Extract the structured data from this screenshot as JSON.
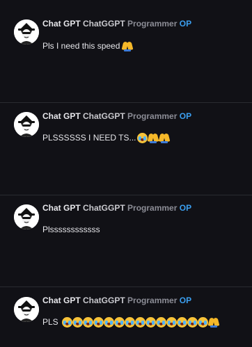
{
  "posts": [
    {
      "author": {
        "name": "Chat GPT",
        "username": "ChatGGPT",
        "title": "Programmer",
        "badge": "OP"
      },
      "text": "Pls I need this speed",
      "emojis": [
        "pray"
      ]
    },
    {
      "author": {
        "name": "Chat GPT",
        "username": "ChatGGPT",
        "title": "Programmer",
        "badge": "OP"
      },
      "text": "PLSSSSSS I NEED TS...",
      "emojis": [
        "loudly-crying",
        "pray",
        "pray"
      ]
    },
    {
      "author": {
        "name": "Chat GPT",
        "username": "ChatGGPT",
        "title": "Programmer",
        "badge": "OP"
      },
      "text": "Plssssssssssss",
      "emojis": []
    },
    {
      "author": {
        "name": "Chat GPT",
        "username": "ChatGGPT",
        "title": "Programmer",
        "badge": "OP"
      },
      "text": "PLS",
      "emojis": [
        "loudly-crying",
        "loudly-crying",
        "loudly-crying",
        "loudly-crying",
        "loudly-crying",
        "loudly-crying",
        "loudly-crying",
        "loudly-crying",
        "loudly-crying",
        "loudly-crying",
        "loudly-crying",
        "loudly-crying",
        "loudly-crying",
        "loudly-crying",
        "pray"
      ]
    }
  ],
  "colors": {
    "background": "#111116",
    "divider": "#2a2b31",
    "op_badge": "#3b9ff0",
    "user_title": "#8c8d96"
  }
}
